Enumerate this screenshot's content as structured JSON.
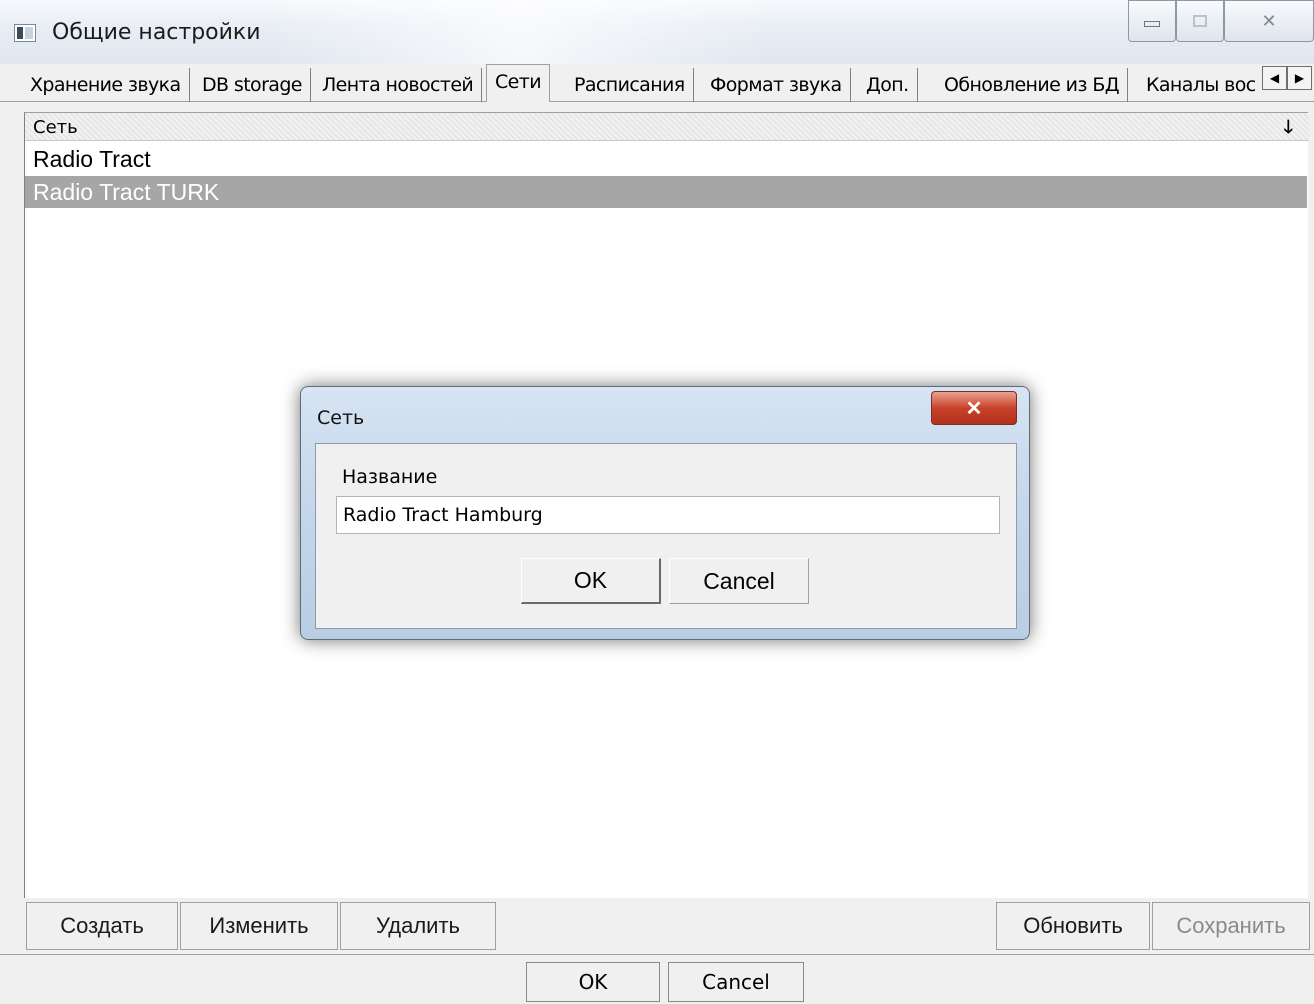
{
  "window": {
    "title": "Общие настройки"
  },
  "tabs": [
    {
      "label": "Хранение звука"
    },
    {
      "label": "DB storage"
    },
    {
      "label": "Лента новостей"
    },
    {
      "label": "Сети"
    },
    {
      "label": "Расписания"
    },
    {
      "label": "Формат звука"
    },
    {
      "label": "Доп."
    },
    {
      "label": "Обновление из БД"
    },
    {
      "label": "Каналы вос"
    }
  ],
  "active_tab": "Сети",
  "list": {
    "column_header": "Сеть",
    "sort_icon": "arrow-down-icon",
    "rows": [
      {
        "name": "Radio Tract",
        "selected": false
      },
      {
        "name": "Radio Tract TURK",
        "selected": true
      }
    ]
  },
  "toolbar": {
    "create_label": "Создать",
    "edit_label": "Изменить",
    "delete_label": "Удалить",
    "refresh_label": "Обновить",
    "save_label": "Сохранить"
  },
  "footer": {
    "ok_label": "OK",
    "cancel_label": "Cancel"
  },
  "dialog": {
    "title": "Сеть",
    "field_label": "Название",
    "field_value": "Radio Tract Hamburg",
    "ok_label": "OK",
    "cancel_label": "Cancel"
  },
  "colors": {
    "selection": "#a6a6a6",
    "close_button": "#c9432c",
    "dialog_frame": "#c4d6ea"
  }
}
